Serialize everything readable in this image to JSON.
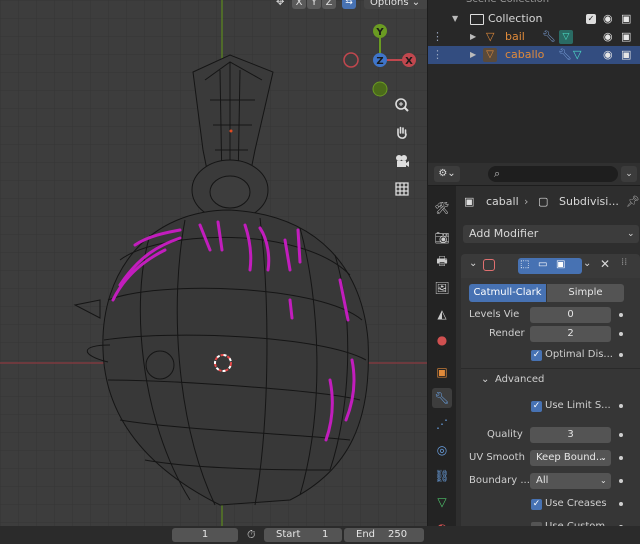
{
  "viewport": {
    "axis_buttons": [
      "X",
      "Y",
      "Z"
    ],
    "options_label": "Options",
    "gizmo": {
      "x": "X",
      "y": "Y",
      "z": "Z"
    },
    "colors": {
      "grid_bg": "#3d3d3d",
      "x_axis": "#c0474e",
      "y_axis": "#6a9b22",
      "wire": "#141414",
      "crease": "#c21dbd"
    }
  },
  "outliner": {
    "scene_label": "Scene Collection",
    "collection_label": "Collection",
    "objects": [
      {
        "name": "bail",
        "color": "#e08a3a"
      },
      {
        "name": "caballo",
        "color": "#e08a3a"
      }
    ]
  },
  "properties": {
    "search_placeholder": "",
    "breadcrumb_object": "caball",
    "breadcrumb_modifier": "Subdivisi...",
    "add_modifier_label": "Add Modifier",
    "modifier": {
      "type_tabs": [
        "Catmull-Clark",
        "Simple"
      ],
      "active_tab": "Catmull-Clark",
      "levels_label": "Levels Vie",
      "levels_value": "0",
      "render_label": "Render",
      "render_value": "2",
      "optimal_display_label": "Optimal Dis...",
      "advanced_label": "Advanced",
      "use_limit_label": "Use Limit S...",
      "quality_label": "Quality",
      "quality_value": "3",
      "uv_smooth_label": "UV Smooth",
      "uv_smooth_value": "Keep Bound...",
      "boundary_label": "Boundary ...",
      "boundary_value": "All",
      "use_creases_label": "Use Creases",
      "use_custom_label": "Use Custom..."
    }
  },
  "timeline": {
    "current_frame": "1",
    "start_label": "Start",
    "start_value": "1",
    "end_label": "End",
    "end_value": "250"
  }
}
